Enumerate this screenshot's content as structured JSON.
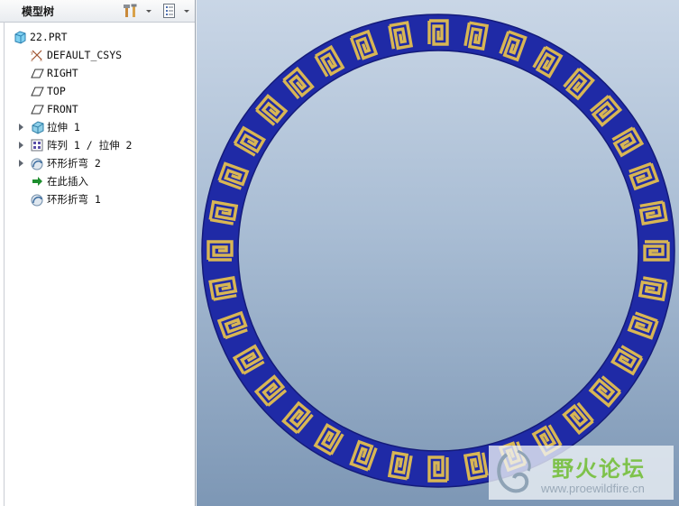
{
  "model_tree": {
    "title": "模型树",
    "header_icons": [
      "tools-icon",
      "dropdown-arrow-icon",
      "tree-columns-icon",
      "dropdown-arrow-icon"
    ],
    "items": [
      {
        "label": "22.PRT",
        "icon": "part-icon",
        "expandable": false
      },
      {
        "label": "DEFAULT_CSYS",
        "icon": "csys-icon",
        "expandable": false
      },
      {
        "label": "RIGHT",
        "icon": "datum-plane-icon",
        "expandable": false
      },
      {
        "label": "TOP",
        "icon": "datum-plane-icon",
        "expandable": false
      },
      {
        "label": "FRONT",
        "icon": "datum-plane-icon",
        "expandable": false
      },
      {
        "label": "拉伸 1",
        "icon": "extrude-icon",
        "expandable": true
      },
      {
        "label": "阵列 1 / 拉伸 2",
        "icon": "pattern-icon",
        "expandable": true
      },
      {
        "label": "环形折弯 2",
        "icon": "toroidal-bend-icon",
        "expandable": true
      },
      {
        "label": "在此插入",
        "icon": "insert-here-arrow-icon",
        "expandable": false
      },
      {
        "label": "环形折弯 1",
        "icon": "toroidal-bend-icon",
        "expandable": false
      }
    ]
  },
  "viewport": {
    "model": "greek-key-ring",
    "colors": {
      "band": "#1f2aa6",
      "pattern": "#d8b654",
      "background_top": "#c9d6e6",
      "background_bottom": "#7d97b5"
    }
  },
  "watermark": {
    "title": "野火论坛",
    "url": "www.proewildfire.cn"
  }
}
